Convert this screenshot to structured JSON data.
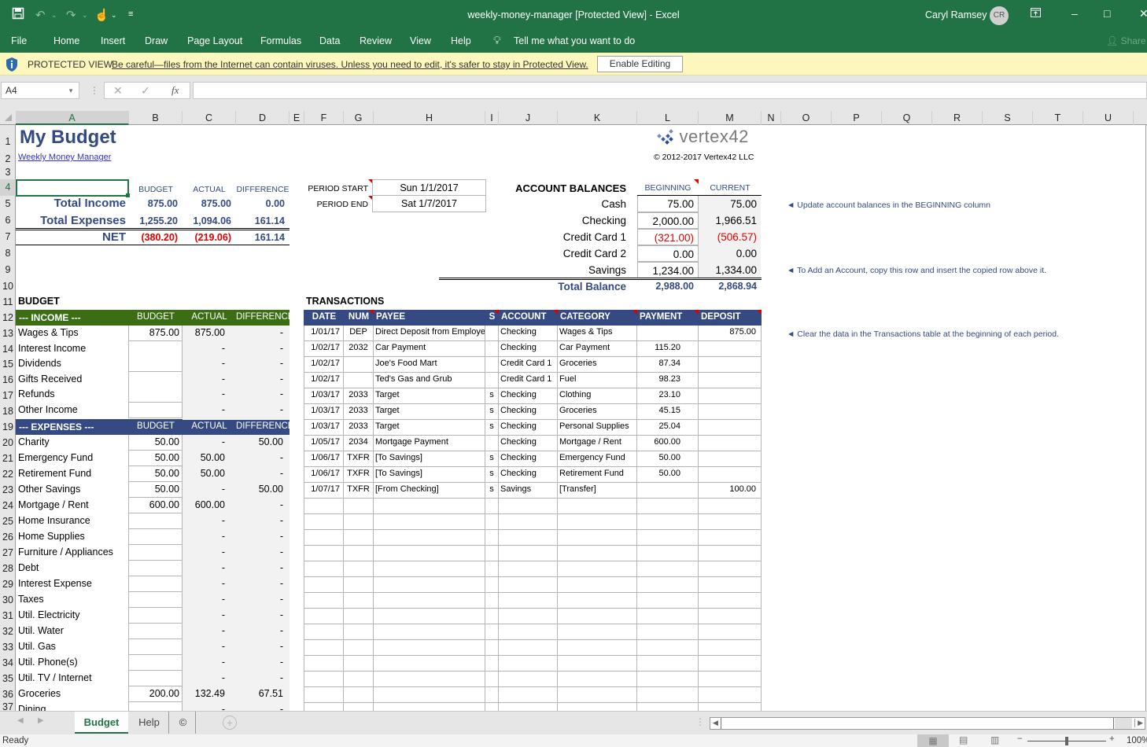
{
  "window": {
    "title": "weekly-money-manager  [Protected View]  -  Excel",
    "user_name": "Caryl Ramsey",
    "user_initials": "CR"
  },
  "ribbon": {
    "tabs": [
      "File",
      "Home",
      "Insert",
      "Draw",
      "Page Layout",
      "Formulas",
      "Data",
      "Review",
      "View",
      "Help"
    ],
    "tell_me": "Tell me what you want to do",
    "share": "Share"
  },
  "protected_view": {
    "label": "PROTECTED VIEW",
    "message": "Be careful—files from the Internet can contain viruses. Unless you need to edit, it's safer to stay in Protected View.",
    "enable_button": "Enable Editing"
  },
  "formula_bar": {
    "name_box": "A4",
    "formula": "",
    "fx": "fx"
  },
  "columns": [
    "A",
    "B",
    "C",
    "D",
    "E",
    "F",
    "G",
    "H",
    "I",
    "J",
    "K",
    "L",
    "M",
    "N",
    "O",
    "P",
    "Q",
    "R",
    "S",
    "T",
    "U"
  ],
  "rows": [
    "1",
    "2",
    "3",
    "4",
    "5",
    "6",
    "7",
    "8",
    "9",
    "10",
    "11",
    "12",
    "13",
    "14",
    "15",
    "16",
    "17",
    "18",
    "19",
    "20",
    "21",
    "22",
    "23",
    "24",
    "25",
    "26",
    "27",
    "28",
    "29",
    "30",
    "31",
    "32",
    "33",
    "34",
    "35",
    "36",
    "37"
  ],
  "sheet": {
    "title": "My Budget",
    "subtitle_link": "Weekly Money Manager",
    "logo_text": "vertex42",
    "copyright": "© 2012-2017 Vertex42 LLC",
    "summary": {
      "headers": [
        "BUDGET",
        "ACTUAL",
        "DIFFERENCE"
      ],
      "rows": [
        {
          "label": "Total Income",
          "budget": "875.00",
          "actual": "875.00",
          "difference": "0.00"
        },
        {
          "label": "Total Expenses",
          "budget": "1,255.20",
          "actual": "1,094.06",
          "difference": "161.14"
        },
        {
          "label": "NET",
          "budget": "(380.20)",
          "actual": "(219.06)",
          "difference": "161.14"
        }
      ]
    },
    "period": {
      "start_label": "PERIOD START",
      "start_value": "Sun 1/1/2017",
      "end_label": "PERIOD END",
      "end_value": "Sat 1/7/2017"
    },
    "accounts": {
      "title": "ACCOUNT BALANCES",
      "headers": [
        "BEGINNING",
        "CURRENT"
      ],
      "rows": [
        {
          "name": "Cash",
          "beginning": "75.00",
          "current": "75.00",
          "negative": false
        },
        {
          "name": "Checking",
          "beginning": "2,000.00",
          "current": "1,966.51",
          "negative": false
        },
        {
          "name": "Credit Card 1",
          "beginning": "(321.00)",
          "current": "(506.57)",
          "negative": true
        },
        {
          "name": "Credit Card 2",
          "beginning": "0.00",
          "current": "0.00",
          "negative": false
        },
        {
          "name": "Savings",
          "beginning": "1,234.00",
          "current": "1,334.00",
          "negative": false
        }
      ],
      "total_label": "Total Balance",
      "total_beginning": "2,988.00",
      "total_current": "2,868.94"
    },
    "notes": [
      "◄ Update account balances in the BEGINNING column",
      "◄ To Add an Account, copy this row and insert the copied row above it.",
      "◄ Clear the data in the Transactions table at the beginning of each period."
    ],
    "budget": {
      "title": "BUDGET",
      "income_header": "--- INCOME ---",
      "expenses_header": "--- EXPENSES ---",
      "col_headers": [
        "BUDGET",
        "ACTUAL",
        "DIFFERENCE"
      ],
      "income": [
        {
          "label": "Wages & Tips",
          "budget": "875.00",
          "actual": "875.00",
          "difference": "-"
        },
        {
          "label": "Interest Income",
          "budget": "",
          "actual": "-",
          "difference": "-"
        },
        {
          "label": "Dividends",
          "budget": "",
          "actual": "-",
          "difference": "-"
        },
        {
          "label": "Gifts Received",
          "budget": "",
          "actual": "-",
          "difference": "-"
        },
        {
          "label": "Refunds",
          "budget": "",
          "actual": "-",
          "difference": "-"
        },
        {
          "label": "Other Income",
          "budget": "",
          "actual": "-",
          "difference": "-"
        }
      ],
      "expenses": [
        {
          "label": "Charity",
          "budget": "50.00",
          "actual": "-",
          "difference": "50.00"
        },
        {
          "label": "Emergency Fund",
          "budget": "50.00",
          "actual": "50.00",
          "difference": "-"
        },
        {
          "label": "Retirement Fund",
          "budget": "50.00",
          "actual": "50.00",
          "difference": "-"
        },
        {
          "label": "Other Savings",
          "budget": "50.00",
          "actual": "-",
          "difference": "50.00"
        },
        {
          "label": "Mortgage / Rent",
          "budget": "600.00",
          "actual": "600.00",
          "difference": "-"
        },
        {
          "label": "Home Insurance",
          "budget": "",
          "actual": "-",
          "difference": "-"
        },
        {
          "label": "Home Supplies",
          "budget": "",
          "actual": "-",
          "difference": "-"
        },
        {
          "label": "Furniture / Appliances",
          "budget": "",
          "actual": "-",
          "difference": "-"
        },
        {
          "label": "Debt",
          "budget": "",
          "actual": "-",
          "difference": "-"
        },
        {
          "label": "Interest Expense",
          "budget": "",
          "actual": "-",
          "difference": "-"
        },
        {
          "label": "Taxes",
          "budget": "",
          "actual": "-",
          "difference": "-"
        },
        {
          "label": "Util. Electricity",
          "budget": "",
          "actual": "-",
          "difference": "-"
        },
        {
          "label": "Util. Water",
          "budget": "",
          "actual": "-",
          "difference": "-"
        },
        {
          "label": "Util. Gas",
          "budget": "",
          "actual": "-",
          "difference": "-"
        },
        {
          "label": "Util. Phone(s)",
          "budget": "",
          "actual": "-",
          "difference": "-"
        },
        {
          "label": "Util. TV / Internet",
          "budget": "",
          "actual": "-",
          "difference": "-"
        },
        {
          "label": "Groceries",
          "budget": "200.00",
          "actual": "132.49",
          "difference": "67.51"
        },
        {
          "label": "Dining",
          "budget": "",
          "actual": "-",
          "difference": "-"
        }
      ]
    },
    "transactions": {
      "title": "TRANSACTIONS",
      "headers": [
        "DATE",
        "NUM",
        "PAYEE",
        "S",
        "ACCOUNT",
        "CATEGORY",
        "PAYMENT",
        "DEPOSIT"
      ],
      "rows": [
        [
          "1/01/17",
          "DEP",
          "Direct Deposit from Employer",
          "",
          "Checking",
          "Wages & Tips",
          "",
          "875.00"
        ],
        [
          "1/02/17",
          "2032",
          "Car Payment",
          "",
          "Checking",
          "Car Payment",
          "115.20",
          ""
        ],
        [
          "1/02/17",
          "",
          "Joe's Food Mart",
          "",
          "Credit Card 1",
          "Groceries",
          "87.34",
          ""
        ],
        [
          "1/02/17",
          "",
          "Ted's Gas and Grub",
          "",
          "Credit Card 1",
          "Fuel",
          "98.23",
          ""
        ],
        [
          "1/03/17",
          "2033",
          "Target",
          "s",
          "Checking",
          "Clothing",
          "23.10",
          ""
        ],
        [
          "1/03/17",
          "2033",
          "Target",
          "s",
          "Checking",
          "Groceries",
          "45.15",
          ""
        ],
        [
          "1/03/17",
          "2033",
          "Target",
          "s",
          "Checking",
          "Personal Supplies",
          "25.04",
          ""
        ],
        [
          "1/05/17",
          "2034",
          "Mortgage Payment",
          "",
          "Checking",
          "Mortgage / Rent",
          "600.00",
          ""
        ],
        [
          "1/06/17",
          "TXFR",
          "[To Savings]",
          "s",
          "Checking",
          "Emergency Fund",
          "50.00",
          ""
        ],
        [
          "1/06/17",
          "TXFR",
          "[To Savings]",
          "s",
          "Checking",
          "Retirement Fund",
          "50.00",
          ""
        ],
        [
          "1/07/17",
          "TXFR",
          "[From Checking]",
          "s",
          "Savings",
          "[Transfer]",
          "",
          "100.00"
        ]
      ]
    }
  },
  "sheet_tabs": [
    "Budget",
    "Help",
    "©"
  ],
  "active_sheet": "Budget",
  "status": {
    "text": "Ready",
    "zoom": "100%"
  },
  "colors": {
    "excel_green": "#217346",
    "navy": "#344a82",
    "income_green": "#3b6e14",
    "expenses_navy": "#354a82",
    "negative_red": "#e00000"
  }
}
